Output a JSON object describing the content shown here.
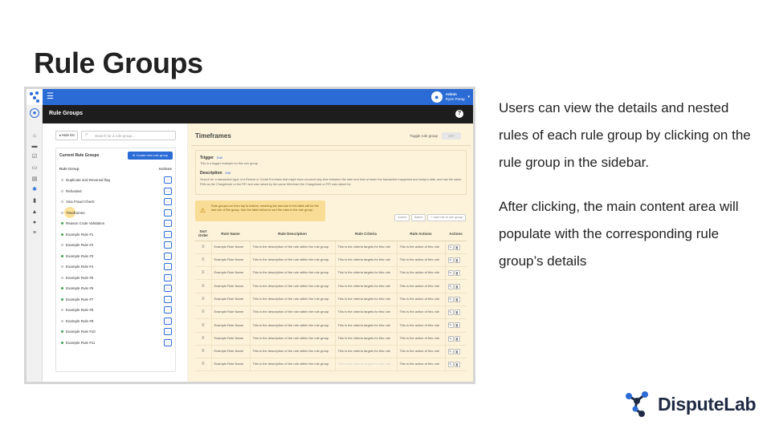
{
  "slide": {
    "title": "Rule Groups",
    "paragraphs": [
      "Users can view the details and nested rules of each rule group by clicking on the rule group in the sidebar.",
      "After clicking, the main content area will populate with the corresponding rule group’s details"
    ],
    "brand": "DisputeLab"
  },
  "app": {
    "user": {
      "role": "Admin",
      "name": "Ryan Parag"
    },
    "page_title": "Rule Groups",
    "left": {
      "hide_label": "◂ Hide list",
      "search_placeholder": "Search for a rule group...",
      "section_title": "Current Rule Groups",
      "create_label": "Create new rule group",
      "col_rule_group": "Rule Group",
      "col_actions": "Actions",
      "groups": [
        {
          "label": "Duplicate and Reversal flag",
          "active": false
        },
        {
          "label": "Refunded",
          "active": false
        },
        {
          "label": "Visa Fraud Check",
          "active": false
        },
        {
          "label": "Timeframes",
          "active": false,
          "selected": true
        },
        {
          "label": "Reason Code Validation",
          "active": true
        },
        {
          "label": "Example Rule #1",
          "active": true
        },
        {
          "label": "Example Rule #2",
          "active": false
        },
        {
          "label": "Example Rule #3",
          "active": true
        },
        {
          "label": "Example Rule #4",
          "active": false
        },
        {
          "label": "Example Rule #5",
          "active": false
        },
        {
          "label": "Example Rule #6",
          "active": true
        },
        {
          "label": "Example Rule #7",
          "active": true
        },
        {
          "label": "Example Rule #8",
          "active": false
        },
        {
          "label": "Example Rule #9",
          "active": false
        },
        {
          "label": "Example Rule #10",
          "active": true
        },
        {
          "label": "Example Rule #11",
          "active": true
        }
      ]
    },
    "main": {
      "title": "Timeframes",
      "toggle_label": "Toggle rule group",
      "toggle_value": "OFF",
      "trigger_label": "Trigger",
      "edit_label": "Edit",
      "trigger_value": "This is a trigger example for this rule group",
      "description_label": "Description",
      "description_value": "Search for a transaction type of a Refund or Credit Purchase that might have occurred any time between the date and time of when the transaction happened and today's date, and has the same PAN as the Chargeback or the RFI and was raised by the same Merchant the Chargeback or RFI was raised for.",
      "alert_text": "Rule groups run from top to bottom, meaning the last rule in the table will be the last rule of the group. Use the table below to sort the rules in the rule group.",
      "action_buttons": [
        "Action",
        "Action",
        "+ Add rule to rule group"
      ],
      "columns": [
        "Sort Order",
        "Rule Name",
        "Rule Description",
        "Rule Criteria",
        "Rule Actions",
        "Actions"
      ],
      "row_count": 10,
      "row": {
        "name": "Example Rule Name",
        "description": "This is the description of the rule within the rule group",
        "criteria": "This is the criteria targets for this rule",
        "action": "This is the action of this rule"
      }
    }
  }
}
